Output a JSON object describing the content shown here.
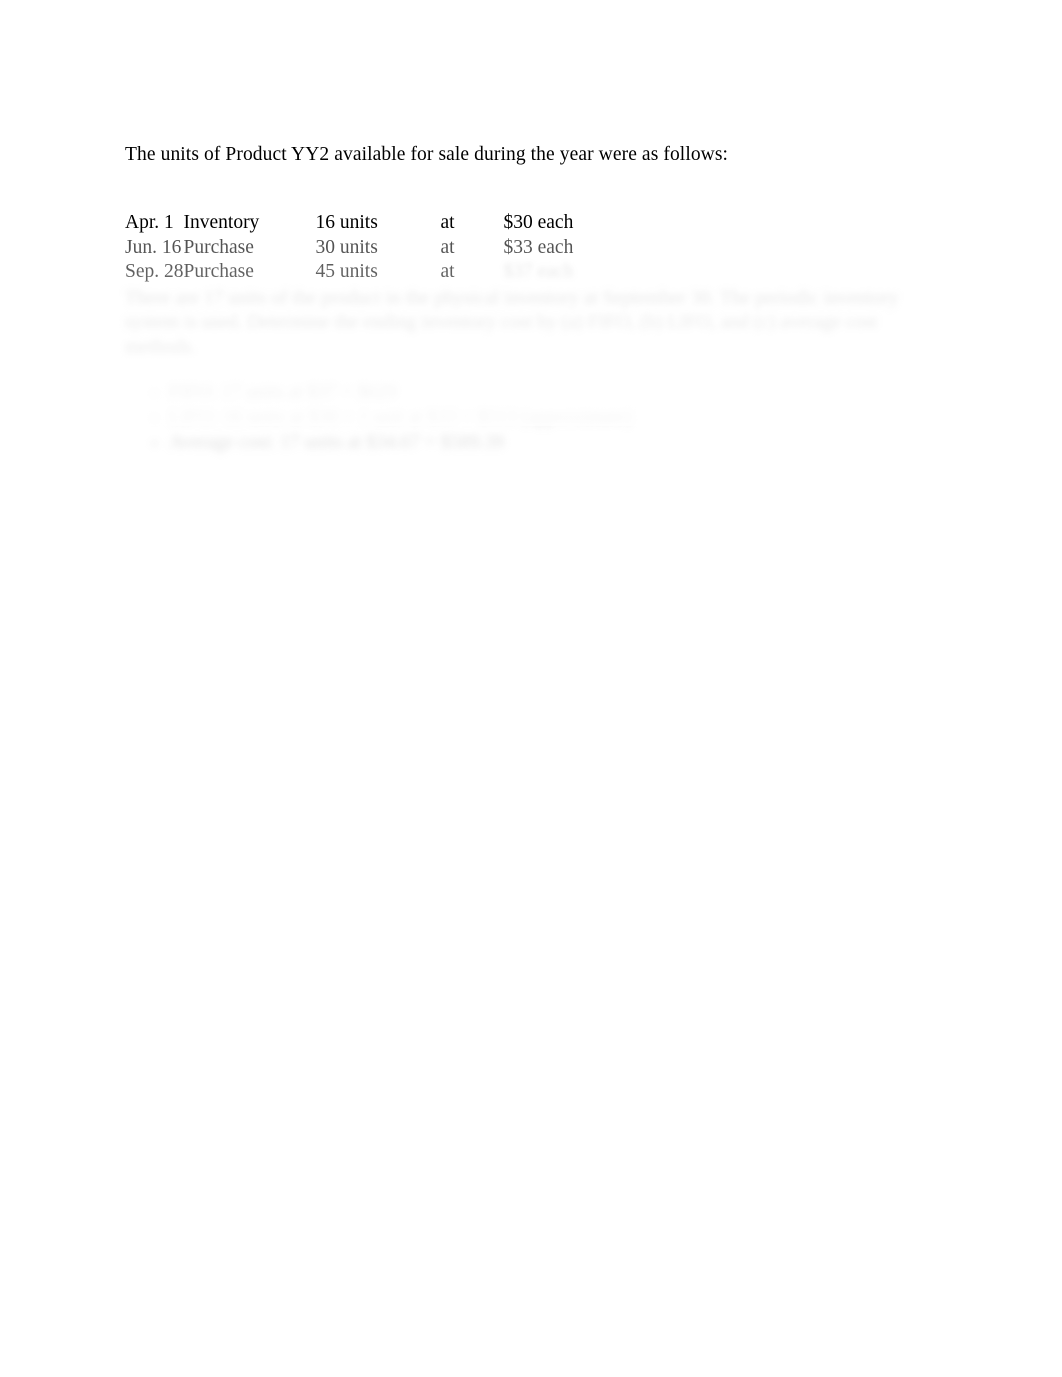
{
  "document": {
    "intro": "The units of Product YY2 available for sale during the year were as follows:",
    "inventory_table": {
      "rows": [
        {
          "date": "Apr. 1",
          "description": "Inventory",
          "units": "16 units",
          "at": "at",
          "price": "$30 each"
        },
        {
          "date": "Jun. 16",
          "description": "Purchase",
          "units": "30 units",
          "at": "at",
          "price": "$33 each"
        },
        {
          "date": "Sep. 28",
          "description": "Purchase",
          "units": "45 units",
          "at": "at",
          "price": "$37 each"
        }
      ]
    },
    "instruction_paragraph": "There are 17 units of the product in the physical inventory at September 30. The periodic inventory system is used. Determine the ending inventory cost by (a) FIFO, (b) LIFO, and (c) average cost methods.",
    "answer_list": [
      "FIFO:  17 units at $37 = $629",
      "LIFO:  16 units at $30 + 1 unit at $33 = $513 (approximate)",
      "Average cost:  17 units at $34.67 = $589.39"
    ]
  }
}
